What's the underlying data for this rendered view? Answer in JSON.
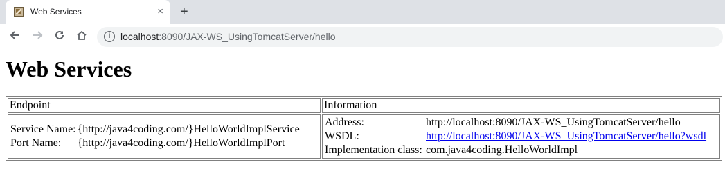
{
  "browser": {
    "tab_title": "Web Services",
    "tab_close_label": "×",
    "new_tab_label": "+",
    "url_host": "localhost",
    "url_rest": ":8090/JAX-WS_UsingTomcatServer/hello",
    "icons": {
      "back": "arrow-left-icon",
      "forward": "arrow-right-icon",
      "reload": "reload-icon",
      "home": "home-icon",
      "info": "info-icon"
    }
  },
  "page": {
    "heading": "Web Services",
    "table": {
      "headers": [
        "Endpoint",
        "Information"
      ],
      "endpoint": [
        {
          "label": "Service Name:",
          "value": "{http://java4coding.com/}HelloWorldImplService"
        },
        {
          "label": "Port Name:",
          "value": "{http://java4coding.com/}HelloWorldImplPort"
        }
      ],
      "information": [
        {
          "label": "Address:",
          "value": "http://localhost:8090/JAX-WS_UsingTomcatServer/hello"
        },
        {
          "label": "WSDL:",
          "value": "http://localhost:8090/JAX-WS_UsingTomcatServer/hello?wsdl"
        },
        {
          "label": "Implementation class:",
          "value": "com.java4coding.HelloWorldImpl"
        }
      ]
    }
  }
}
